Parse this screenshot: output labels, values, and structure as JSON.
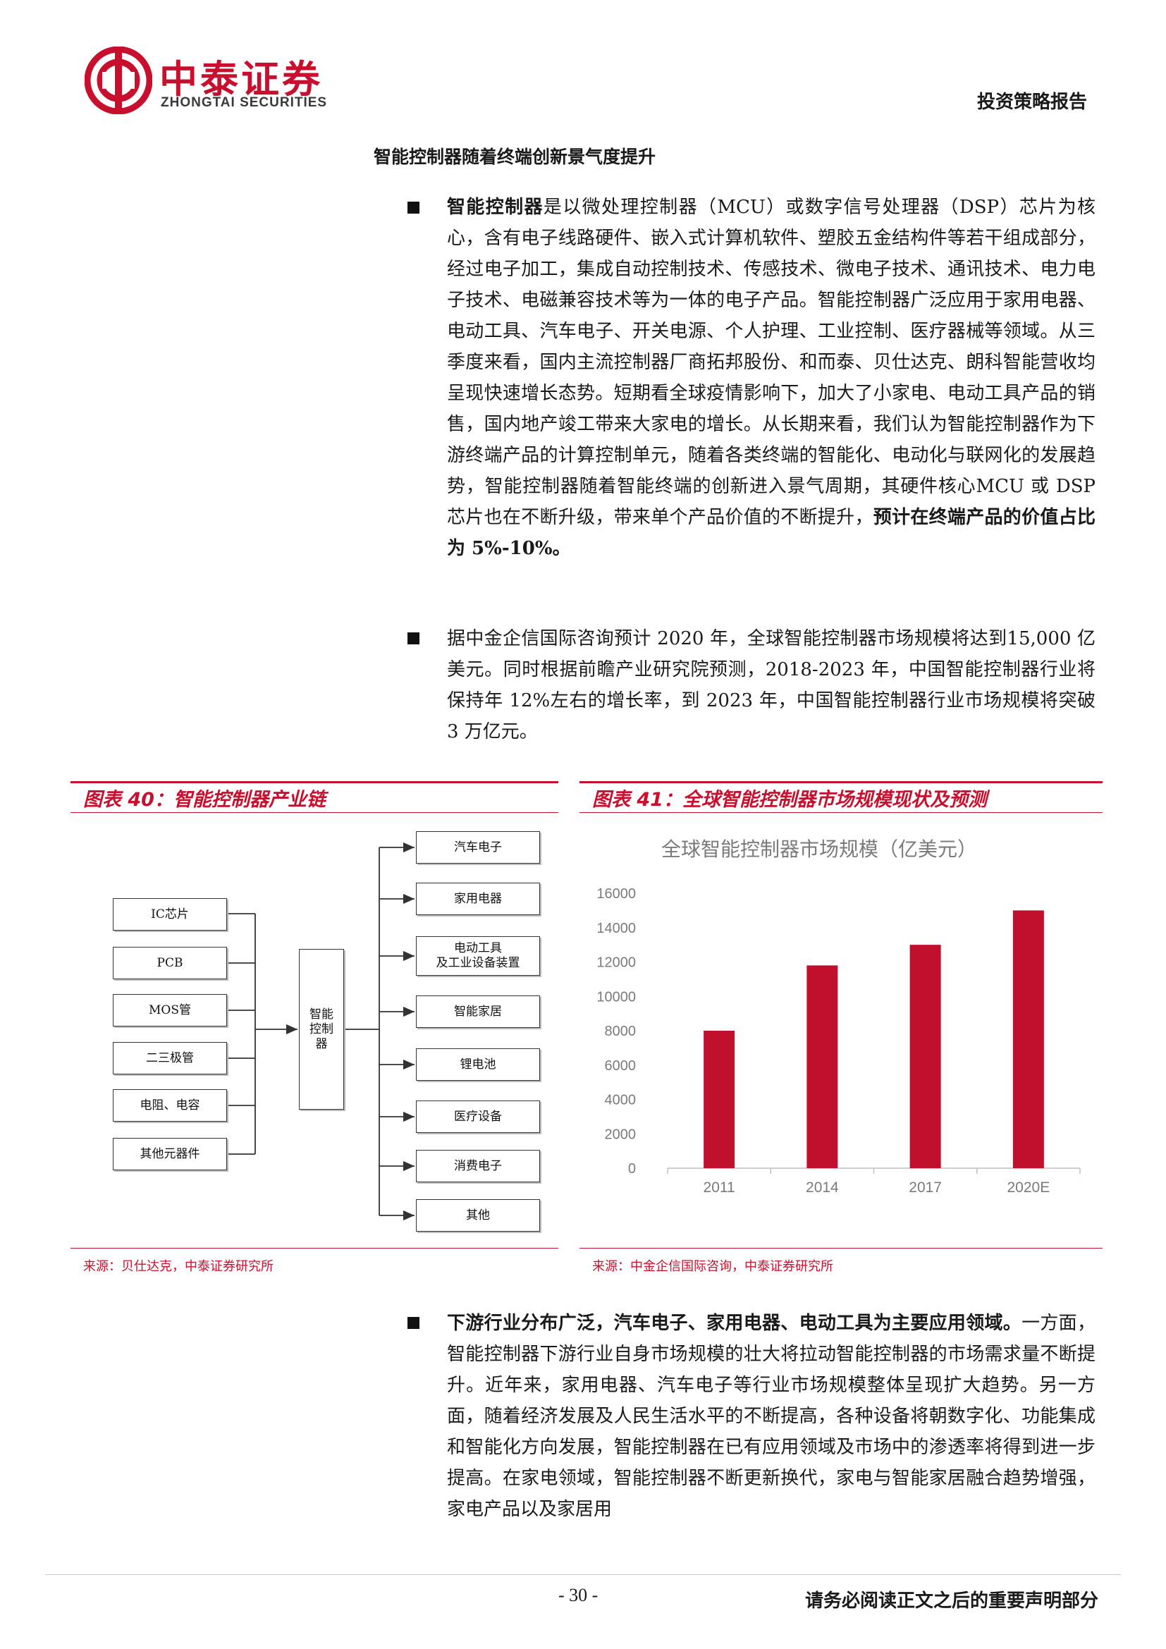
{
  "header": {
    "logo_cn": "中泰证券",
    "logo_en": "ZHONGTAI SECURITIES",
    "report_type": "投资策略报告"
  },
  "section_title": "智能控制器随着终端创新景气度提升",
  "paragraphs": [
    {
      "lead_bold": "智能控制器",
      "text": "是以微处理控制器（MCU）或数字信号处理器（DSP）芯片为核心，含有电子线路硬件、嵌入式计算机软件、塑胶五金结构件等若干组成部分，经过电子加工，集成自动控制技术、传感技术、微电子技术、通讯技术、电力电子技术、电磁兼容技术等为一体的电子产品。智能控制器广泛应用于家用电器、电动工具、汽车电子、开关电源、个人护理、工业控制、医疗器械等领域。从三季度来看，国内主流控制器厂商拓邦股份、和而泰、贝仕达克、朗科智能营收均呈现快速增长态势。短期看全球疫情影响下，加大了小家电、电动工具产品的销售，国内地产竣工带来大家电的增长。从长期来看，我们认为智能控制器作为下游终端产品的计算控制单元，随着各类终端的智能化、电动化与联网化的发展趋势，智能控制器随着智能终端的创新进入景气周期，其硬件核心MCU 或 DSP 芯片也在不断升级，带来单个产品价值的不断提升，",
      "tail_bold": "预计在终端产品的价值占比为 5%-10%。"
    },
    {
      "text": "据中金企信国际咨询预计 2020 年，全球智能控制器市场规模将达到15,000 亿美元。同时根据前瞻产业研究院预测，2018-2023 年，中国智能控制器行业将保持年 12%左右的增长率，到 2023 年，中国智能控制器行业市场规模将突破 3 万亿元。"
    },
    {
      "lead_bold": "下游行业分布广泛，汽车电子、家用电器、电动工具为主要应用领域。",
      "text": "一方面，智能控制器下游行业自身市场规模的壮大将拉动智能控制器的市场需求量不断提升。近年来，家用电器、汽车电子等行业市场规模整体呈现扩大趋势。另一方面，随着经济发展及人民生活水平的不断提高，各种设备将朝数字化、功能集成和智能化方向发展，智能控制器在已有应用领域及市场中的渗透率将得到进一步提高。在家电领域，智能控制器不断更新换代，家电与智能家居融合趋势增强，家电产品以及家居用"
    }
  ],
  "figure40": {
    "title": "图表 40：智能控制器产业链",
    "inputs": [
      "IC芯片",
      "PCB",
      "MOS管",
      "二三极管",
      "电阻、电容",
      "其他元器件"
    ],
    "center": "智能\n控制\n器",
    "outputs": [
      "汽车电子",
      "家用电器",
      "电动工具\n及工业设备装置",
      "智能家居",
      "锂电池",
      "医疗设备",
      "消费电子",
      "其他"
    ],
    "source": "来源：贝仕达克，中泰证券研究所"
  },
  "figure41": {
    "title": "图表 41：全球智能控制器市场规模现状及预测",
    "source": "来源：中金企信国际咨询，中泰证券研究所"
  },
  "chart_data": {
    "type": "bar",
    "title": "全球智能控制器市场规模（亿美元）",
    "categories": [
      "2011",
      "2014",
      "2017",
      "2020E"
    ],
    "values": [
      8000,
      11800,
      13000,
      15000
    ],
    "ylim": [
      0,
      16000
    ],
    "yticks": [
      0,
      2000,
      4000,
      6000,
      8000,
      10000,
      12000,
      14000,
      16000
    ],
    "bar_color": "#c0102e",
    "grid": false,
    "legend": "none"
  },
  "footer": {
    "page": "- 30 -",
    "note": "请务必阅读正文之后的重要声明部分"
  }
}
